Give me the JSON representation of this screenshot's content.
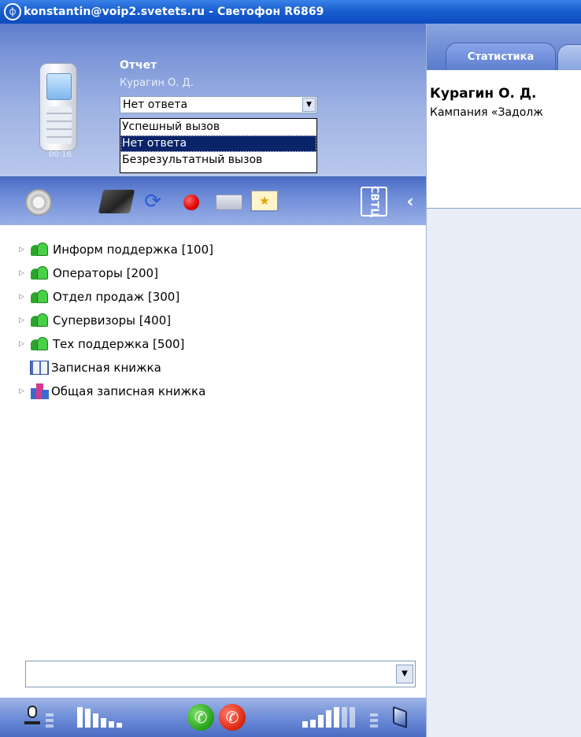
{
  "window": {
    "title": "konstantin@voip2.svetets.ru - Светофон R6869",
    "logo_icon": "svetofon-logo-icon"
  },
  "call": {
    "report_label": "Отчет",
    "caller_name": "Курагин О. Д.",
    "timer": "00:16",
    "result_select": {
      "selected": "Нет ответа",
      "options": [
        "Успешный вызов",
        "Нет ответа",
        "Безрезультатный вызов"
      ],
      "highlighted_index": 1
    }
  },
  "toolbar": {
    "icons": [
      "gear-icon",
      "book-icon",
      "refresh-icon",
      "record-icon",
      "transfer-icon",
      "card-icon",
      "svetets-logo-icon",
      "collapse-icon"
    ],
    "logo_text": "СВТЦ"
  },
  "tree": {
    "items": [
      {
        "label": "Информ поддержка [100]",
        "icon": "group-icon",
        "expandable": true
      },
      {
        "label": "Операторы [200]",
        "icon": "group-icon",
        "expandable": true
      },
      {
        "label": "Отдел продаж [300]",
        "icon": "group-icon",
        "expandable": true
      },
      {
        "label": "Супервизоры [400]",
        "icon": "group-icon",
        "expandable": true
      },
      {
        "label": "Тех поддержка [500]",
        "icon": "group-icon",
        "expandable": true
      },
      {
        "label": "Записная книжка",
        "icon": "address-book-icon",
        "expandable": false
      },
      {
        "label": "Общая записная книжка",
        "icon": "shared-book-icon",
        "expandable": true
      }
    ]
  },
  "search": {
    "value": ""
  },
  "statusbar": {
    "mic_level": 0.6,
    "speaker_level": 0.6,
    "accept_icon": "phone-accept-icon",
    "reject_icon": "phone-reject-icon"
  },
  "right": {
    "tabs": [
      {
        "label": "Статистика",
        "active": true
      }
    ],
    "caller_name": "Курагин О. Д.",
    "campaign": "Кампания «Задолж"
  },
  "colors": {
    "titlebar": "#1a5fd0",
    "selection": "#0a246a",
    "accept": "#2aa51c",
    "reject": "#e02a14"
  }
}
